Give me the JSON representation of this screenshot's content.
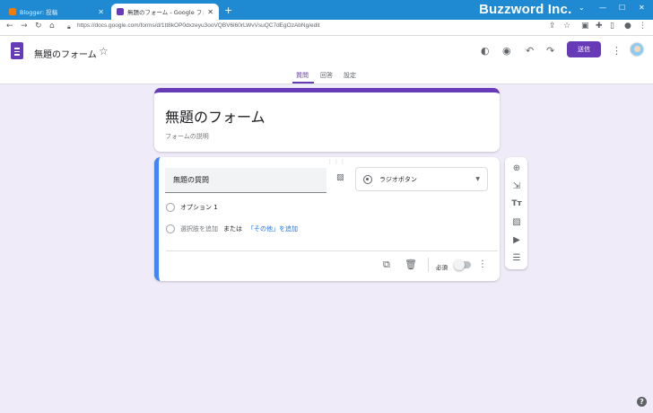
{
  "browser": {
    "tabs": [
      {
        "title": "Blogger: 投稿",
        "active": false,
        "favicon_color": "#f57c00"
      },
      {
        "title": "無題のフォーム - Google フォーム",
        "active": true,
        "favicon_color": "#673ab7"
      }
    ],
    "new_tab_icon": "plus-icon",
    "brand": "Buzzword Inc.",
    "url": "https://docs.google.com/forms/d/1tt8kOP0dxzeyu3ooVQBV6l60rLWvVsuQC7dEgOzAbNg/edit"
  },
  "header": {
    "form_title": "無題のフォーム",
    "send_label": "送信",
    "tabs": [
      "質問",
      "回答",
      "設定"
    ],
    "active_tab": 0,
    "accent_color": "#673ab7"
  },
  "title_card": {
    "title": "無題のフォーム",
    "description_placeholder": "フォームの説明"
  },
  "question": {
    "title": "無題の質問",
    "type_label": "ラジオボタン",
    "options": [
      "オプション 1"
    ],
    "add_option": "選択肢を追加",
    "or": "または",
    "add_other": "「その他」を追加",
    "required_label": "必須",
    "required": false
  },
  "side_tools": [
    "add-question-icon",
    "import-questions-icon",
    "add-title-icon",
    "add-image-icon",
    "add-video-icon",
    "add-section-icon"
  ]
}
